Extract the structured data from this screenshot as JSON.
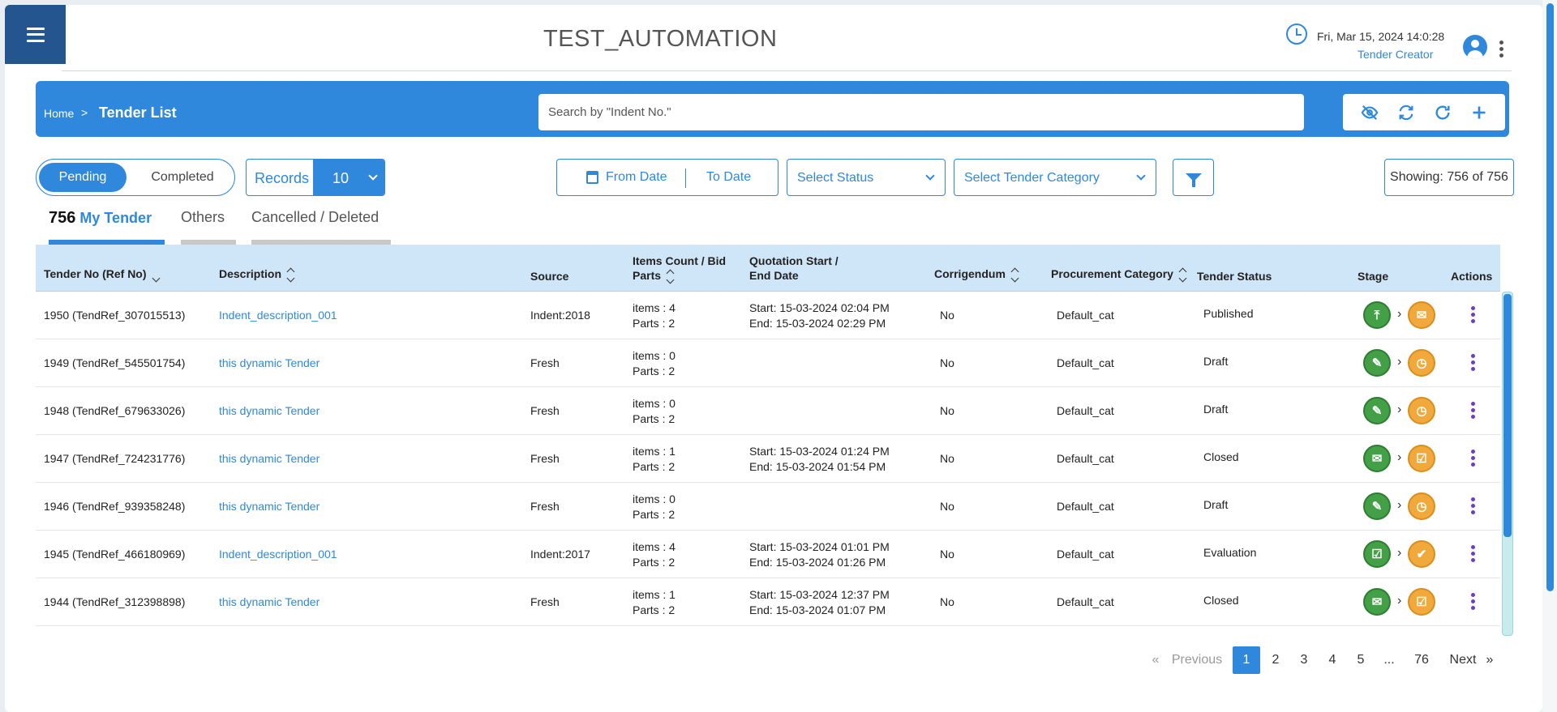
{
  "app": {
    "title": "TEST_AUTOMATION",
    "datetime": "Fri, Mar 15, 2024 14:0:28",
    "role": "Tender Creator"
  },
  "breadcrumb": {
    "home": "Home",
    "separator": ">",
    "current": "Tender List"
  },
  "search": {
    "placeholder": "Search by \"Indent No.\"",
    "value": ""
  },
  "toolbar": {
    "icons": [
      "eye-off-icon",
      "sync-icon",
      "refresh-icon",
      "plus-icon"
    ]
  },
  "filters": {
    "toggle": {
      "active": "Pending",
      "inactive": "Completed"
    },
    "records_label": "Records",
    "records_value": "10",
    "from_date": "From Date",
    "to_date": "To Date",
    "status_placeholder": "Select Status",
    "category_placeholder": "Select Tender Category",
    "showing": "Showing: 756 of 756"
  },
  "tabs": {
    "my_count": "756",
    "my_label": "My Tender",
    "others": "Others",
    "cancelled": "Cancelled / Deleted"
  },
  "table": {
    "headers": {
      "tender_no": "Tender No (Ref No)",
      "description": "Description",
      "source": "Source",
      "items_1": "Items Count / Bid",
      "items_2": "Parts",
      "quotation_1": "Quotation Start /",
      "quotation_2": "End Date",
      "corrigendum": "Corrigendum",
      "procurement": "Procurement Category",
      "status": "Tender Status",
      "stage": "Stage",
      "actions": "Actions"
    },
    "rows": [
      {
        "tender_no": "1950 (TendRef_307015513)",
        "description": "Indent_description_001",
        "source": "Indent:2018",
        "items": "items : 4",
        "parts": "Parts : 2",
        "start": "Start: 15-03-2024 02:04 PM",
        "end": "End: 15-03-2024 02:29 PM",
        "corrigendum": "No",
        "category": "Default_cat",
        "status": "Published",
        "stage_a": "⤒",
        "stage_b": "✉",
        "stage_sep": "›"
      },
      {
        "tender_no": "1949 (TendRef_545501754)",
        "description": "this dynamic Tender",
        "source": "Fresh",
        "items": "items : 0",
        "parts": "Parts : 2",
        "start": "",
        "end": "",
        "corrigendum": "No",
        "category": "Default_cat",
        "status": "Draft",
        "stage_a": "✎",
        "stage_b": "◷",
        "stage_sep": "›"
      },
      {
        "tender_no": "1948 (TendRef_679633026)",
        "description": "this dynamic Tender",
        "source": "Fresh",
        "items": "items : 0",
        "parts": "Parts : 2",
        "start": "",
        "end": "",
        "corrigendum": "No",
        "category": "Default_cat",
        "status": "Draft",
        "stage_a": "✎",
        "stage_b": "◷",
        "stage_sep": "›"
      },
      {
        "tender_no": "1947 (TendRef_724231776)",
        "description": "this dynamic Tender",
        "source": "Fresh",
        "items": "items : 1",
        "parts": "Parts : 2",
        "start": "Start: 15-03-2024 01:24 PM",
        "end": "End: 15-03-2024 01:54 PM",
        "corrigendum": "No",
        "category": "Default_cat",
        "status": "Closed",
        "stage_a": "✉",
        "stage_b": "☑",
        "stage_sep": "›"
      },
      {
        "tender_no": "1946 (TendRef_939358248)",
        "description": "this dynamic Tender",
        "source": "Fresh",
        "items": "items : 0",
        "parts": "Parts : 2",
        "start": "",
        "end": "",
        "corrigendum": "No",
        "category": "Default_cat",
        "status": "Draft",
        "stage_a": "✎",
        "stage_b": "◷",
        "stage_sep": "›"
      },
      {
        "tender_no": "1945 (TendRef_466180969)",
        "description": "Indent_description_001",
        "source": "Indent:2017",
        "items": "items : 4",
        "parts": "Parts : 2",
        "start": "Start: 15-03-2024 01:01 PM",
        "end": "End: 15-03-2024 01:26 PM",
        "corrigendum": "No",
        "category": "Default_cat",
        "status": "Evaluation",
        "stage_a": "☑",
        "stage_b": "✔",
        "stage_sep": "›"
      },
      {
        "tender_no": "1944 (TendRef_312398898)",
        "description": "this dynamic Tender",
        "source": "Fresh",
        "items": "items : 1",
        "parts": "Parts : 2",
        "start": "Start: 15-03-2024 12:37 PM",
        "end": "End: 15-03-2024 01:07 PM",
        "corrigendum": "No",
        "category": "Default_cat",
        "status": "Closed",
        "stage_a": "✉",
        "stage_b": "☑",
        "stage_sep": "›"
      }
    ]
  },
  "pagination": {
    "first": "«",
    "previous": "Previous",
    "pages": [
      "1",
      "2",
      "3",
      "4",
      "5",
      "...",
      "76"
    ],
    "active": "1",
    "next": "Next",
    "last": "»"
  },
  "colors": {
    "primary": "#2f88db",
    "header_dark": "#24558f",
    "table_header": "#cfe5f8",
    "stage_green": "#43a047",
    "stage_orange": "#f2a93b",
    "action_purple": "#6a3fc0"
  }
}
